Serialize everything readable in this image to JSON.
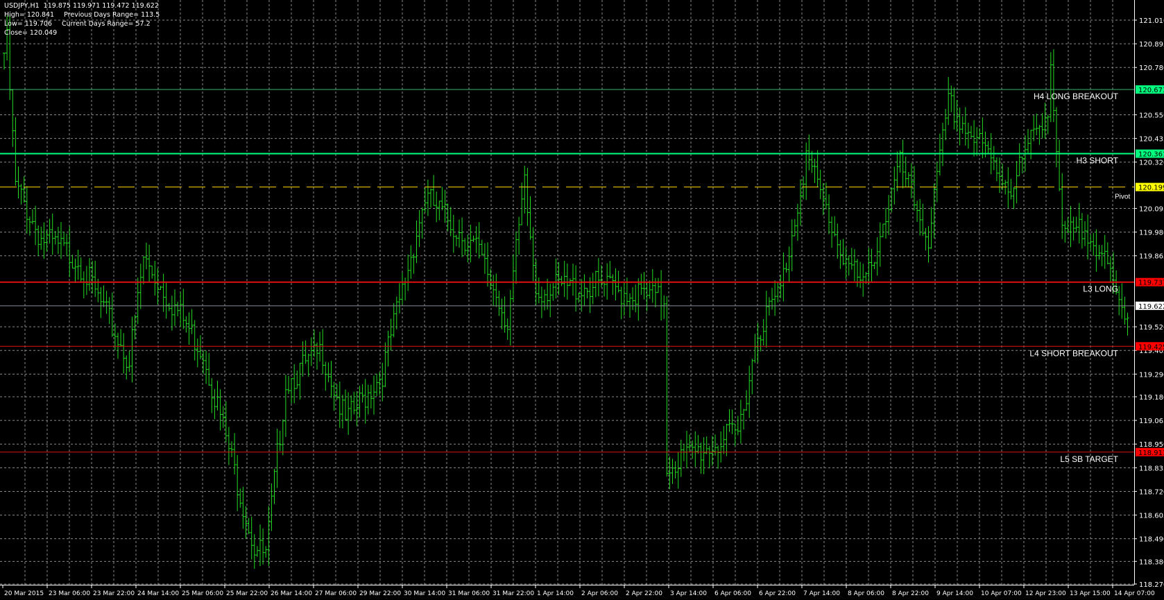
{
  "header": {
    "symbol_line": "USDJPY,H1  119.875 119.971 119.472 119.622",
    "high": "High= 120.841",
    "prev_range": "Previous Days Range= 113.5",
    "low": "Low= 119.706",
    "cur_range": "Current Days Range= 57.2",
    "close": "Close= 120.049"
  },
  "chart_data": {
    "type": "ohlc-bar",
    "symbol": "USDJPY",
    "timeframe": "H1",
    "ylim": [
      118.25,
      121.07
    ],
    "y_ticks": [
      "121.010",
      "120.895",
      "120.780",
      "120.550",
      "120.435",
      "120.320",
      "120.095",
      "119.980",
      "119.865",
      "119.520",
      "119.405",
      "119.290",
      "119.180",
      "119.065",
      "118.950",
      "118.835",
      "118.720",
      "118.605",
      "118.490",
      "118.380",
      "118.270"
    ],
    "x_ticks": [
      "20 Mar 2015",
      "23 Mar 06:00",
      "23 Mar 22:00",
      "24 Mar 14:00",
      "25 Mar 06:00",
      "25 Mar 22:00",
      "26 Mar 14:00",
      "27 Mar 06:00",
      "29 Mar 22:00",
      "30 Mar 14:00",
      "31 Mar 06:00",
      "31 Mar 22:00",
      "1 Apr 14:00",
      "2 Apr 06:00",
      "2 Apr 22:00",
      "3 Apr 14:00",
      "6 Apr 06:00",
      "6 Apr 22:00",
      "7 Apr 14:00",
      "8 Apr 06:00",
      "8 Apr 22:00",
      "9 Apr 14:00",
      "10 Apr 07:00",
      "12 Apr 23:00",
      "13 Apr 15:00",
      "14 Apr 07:00"
    ],
    "bars_per_label": 17,
    "approx_close_path": [
      [
        0,
        120.85
      ],
      [
        1,
        120.9
      ],
      [
        4,
        120.2
      ],
      [
        13,
        119.95
      ],
      [
        26,
        119.85
      ],
      [
        44,
        119.35
      ],
      [
        49,
        119.85
      ],
      [
        70,
        119.4
      ],
      [
        88,
        118.45
      ],
      [
        92,
        118.4
      ],
      [
        99,
        119.25
      ],
      [
        112,
        119.4
      ],
      [
        120,
        119.05
      ],
      [
        133,
        119.3
      ],
      [
        148,
        120.15
      ],
      [
        166,
        119.9
      ],
      [
        177,
        119.55
      ],
      [
        183,
        120.2
      ],
      [
        187,
        119.7
      ],
      [
        208,
        119.72
      ],
      [
        232,
        119.65
      ],
      [
        233,
        118.85
      ],
      [
        242,
        118.9
      ],
      [
        258,
        119.0
      ],
      [
        265,
        119.5
      ],
      [
        273,
        119.7
      ],
      [
        276,
        119.9
      ],
      [
        282,
        120.35
      ],
      [
        294,
        119.9
      ],
      [
        302,
        119.7
      ],
      [
        315,
        120.3
      ],
      [
        325,
        119.95
      ],
      [
        332,
        120.6
      ],
      [
        343,
        120.4
      ],
      [
        354,
        120.2
      ],
      [
        367,
        120.6
      ],
      [
        368,
        120.8
      ],
      [
        372,
        119.95
      ],
      [
        382,
        120.0
      ],
      [
        393,
        119.6
      ],
      [
        395,
        119.62
      ]
    ],
    "levels": [
      {
        "name": "H4 LONG BREAKOUT",
        "price": "120.673",
        "color": "#3cb371",
        "tag_bg": "#00ff7f",
        "tag_fg": "#000000",
        "style": "solid"
      },
      {
        "name": "H3 SHORT",
        "price": "120.361",
        "color": "#00ff7f",
        "tag_bg": "#00ff7f",
        "tag_fg": "#000000",
        "style": "solid-thick"
      },
      {
        "name": "Pivot",
        "price": "120.199",
        "color": "#ffd700",
        "tag_bg": "#ffff00",
        "tag_fg": "#000000",
        "style": "dashed"
      },
      {
        "name": "L3 LONG",
        "price": "119.737",
        "color": "#e01010",
        "tag_bg": "#ff0000",
        "tag_fg": "#000000",
        "style": "solid-thick"
      },
      {
        "name": "",
        "price": "119.622",
        "color": "#8a8f9a",
        "tag_bg": "#ffffff",
        "tag_fg": "#000000",
        "style": "bid"
      },
      {
        "name": "L4 SHORT BREAKOUT",
        "price": "119.425",
        "color": "#e01010",
        "tag_bg": "#ff0000",
        "tag_fg": "#000000",
        "style": "solid"
      },
      {
        "name": "L5 SB TARGET",
        "price": "118.911",
        "color": "#e01010",
        "tag_bg": "#ff0000",
        "tag_fg": "#000000",
        "style": "solid"
      }
    ],
    "colors": {
      "bars": "#22dd22",
      "grid": "#8a8a8a",
      "background": "#000000",
      "axis": "#ffffff"
    }
  }
}
